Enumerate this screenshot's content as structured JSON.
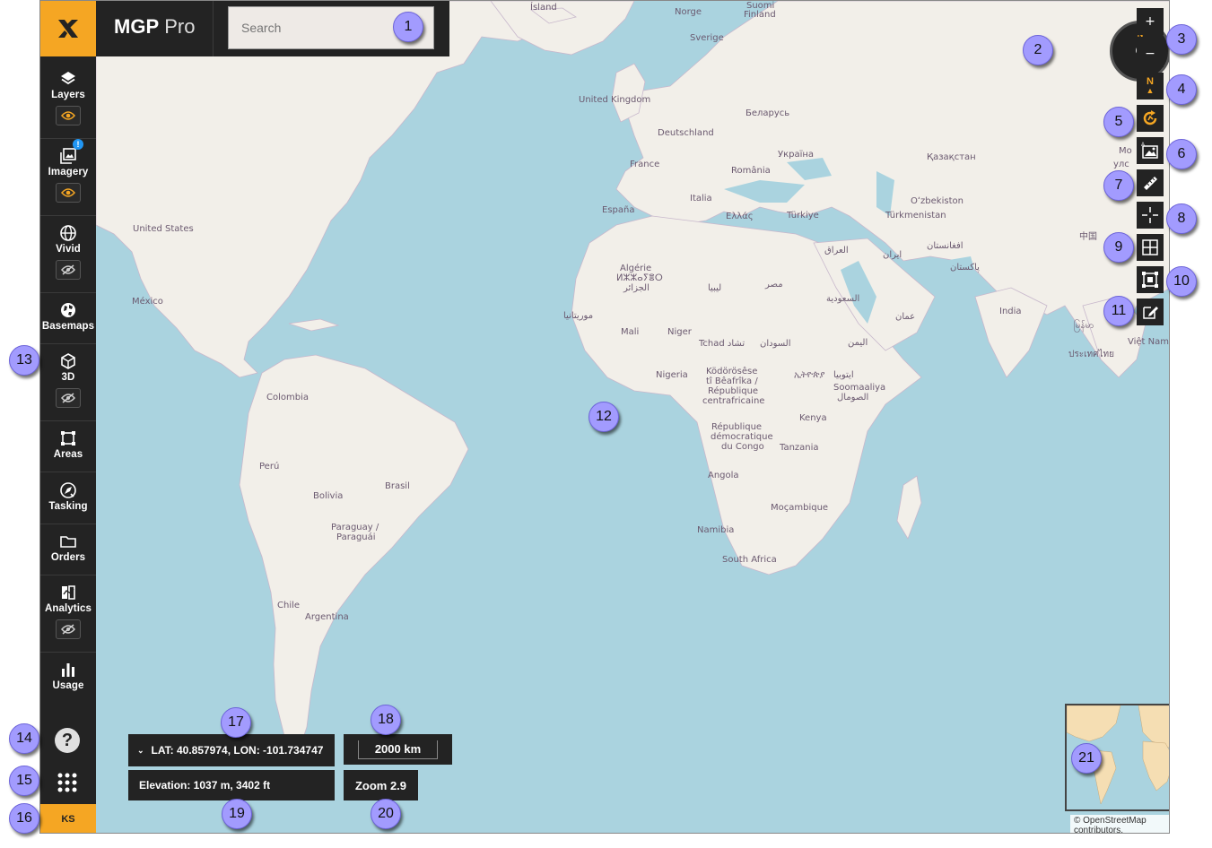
{
  "app": {
    "title_bold": "MGP",
    "title_light": "Pro"
  },
  "search": {
    "placeholder": "Search"
  },
  "sidebar": {
    "items": [
      {
        "label": "Layers",
        "icon": "layers-icon",
        "visibility": "visible"
      },
      {
        "label": "Imagery",
        "icon": "imagery-icon",
        "visibility": "visible",
        "badge": "!"
      },
      {
        "label": "Vivid",
        "icon": "globe-icon",
        "visibility": "hidden"
      },
      {
        "label": "Basemaps",
        "icon": "basemap-globe-icon"
      },
      {
        "label": "3D",
        "icon": "cube-icon",
        "visibility": "hidden"
      },
      {
        "label": "Areas",
        "icon": "area-square-icon"
      },
      {
        "label": "Tasking",
        "icon": "tasking-satellite-icon"
      },
      {
        "label": "Orders",
        "icon": "folder-icon"
      },
      {
        "label": "Analytics",
        "icon": "analytics-icon",
        "visibility": "hidden"
      },
      {
        "label": "Usage",
        "icon": "bar-chart-icon"
      }
    ],
    "help": "?",
    "user_initials": "KS"
  },
  "compass": {
    "north": "N",
    "heading": "0°"
  },
  "map_controls": {
    "zoom_in": "+",
    "zoom_out": "−",
    "north_up": "N"
  },
  "status": {
    "coords": "LAT: 40.857974, LON: -101.734747",
    "scale": "2000 km",
    "elevation": "Elevation: 1037 m, 3402 ft",
    "zoom": "Zoom 2.9"
  },
  "attribution": "© OpenStreetMap contributors.",
  "map_labels": [
    "Ísland",
    "Norge",
    "Suomi",
    "Finland",
    "Sverige",
    "United Kingdom",
    "Беларусь",
    "Deutschland",
    "Україна",
    "France",
    "România",
    "Қазақстан",
    "Mo",
    "улс",
    "Italia",
    "Oʻzbekiston",
    "España",
    "Ελλάς",
    "Türkiye",
    "Türkmenistan",
    "United States",
    "العراق",
    "افغانستان",
    "ایران",
    "پاکستان",
    "Algérie",
    "ⵍⵣⵣⴰⵢⴻⵔ",
    "الجزائر",
    "ليبيا",
    "مصر",
    "México",
    "السعودية",
    "India",
    "موريتانيا",
    "عمان",
    "中国",
    "Mali",
    "Niger",
    "Tchad تشاد",
    "السودان",
    "اليمن",
    "မြန်မာ",
    "Việt Nam",
    "Nigeria",
    "Ködörösêse",
    "tî Bêafrîka /",
    "République",
    "centrafricaine",
    "ኢትዮጵያ",
    "ايتوبيا",
    "Soomaaliya",
    "الصومال",
    "Colombia",
    "ประเทศไทย",
    "République",
    "démocratique",
    "du Congo",
    "Kenya",
    "Perú",
    "Brasil",
    "Tanzania",
    "Bolivia",
    "Angola",
    "Paraguay /",
    "Paraguái",
    "Moçambique",
    "Namibia",
    "South Africa",
    "Chile",
    "Argentina"
  ],
  "callouts": [
    "1",
    "2",
    "3",
    "4",
    "5",
    "6",
    "7",
    "8",
    "9",
    "10",
    "11",
    "12",
    "13",
    "14",
    "15",
    "16",
    "17",
    "18",
    "19",
    "20",
    "21"
  ]
}
